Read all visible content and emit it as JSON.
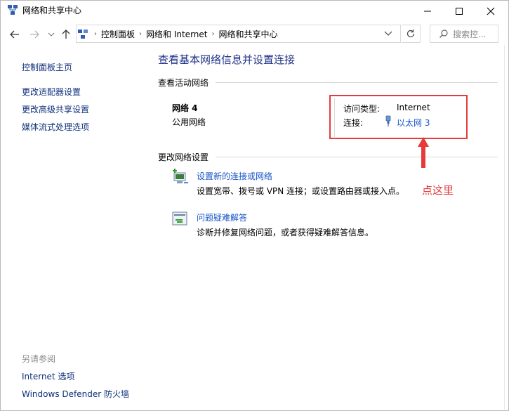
{
  "window": {
    "title": "网络和共享中心"
  },
  "address_bar": {
    "crumbs": [
      "控制面板",
      "网络和 Internet",
      "网络和共享中心"
    ],
    "search_placeholder": "搜索控..."
  },
  "sidebar": {
    "home": "控制面板主页",
    "items": [
      "更改适配器设置",
      "更改高级共享设置",
      "媒体流式处理选项"
    ],
    "see_also_label": "另请参阅",
    "see_also": [
      "Internet 选项",
      "Windows Defender 防火墙"
    ]
  },
  "main": {
    "title": "查看基本网络信息并设置连接",
    "active_section": "查看活动网络",
    "network": {
      "name": "网络 4",
      "type": "公用网络",
      "access_label": "访问类型:",
      "access_value": "Internet",
      "conn_label": "连接:",
      "conn_value": "以太网 3"
    },
    "change_section": "更改网络设置",
    "tasks": [
      {
        "link": "设置新的连接或网络",
        "desc": "设置宽带、拨号或 VPN 连接；或设置路由器或接入点。"
      },
      {
        "link": "问题疑难解答",
        "desc": "诊断并修复网络问题，或者获得疑难解答信息。"
      }
    ]
  },
  "annotation": {
    "text": "点这里",
    "color": "#e53b3b"
  },
  "colors": {
    "link": "#1a56c7",
    "title": "#1e3287"
  },
  "icons": {
    "app": "network-center-icon",
    "connection": "ethernet-plug-icon",
    "task1": "new-connection-icon",
    "task2": "troubleshoot-icon"
  }
}
